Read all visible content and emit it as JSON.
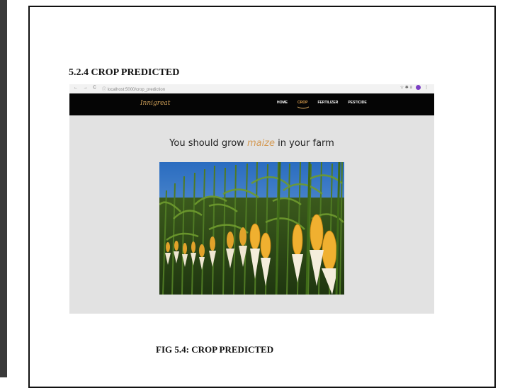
{
  "document": {
    "section_heading": "5.2.4 CROP PREDICTED",
    "caption": "FIG 5.4: CROP PREDICTED"
  },
  "browser": {
    "nav_icons": "← → C",
    "url": "ⓘ localhost:5000/crop_prediction",
    "right_icons": "☆ ✱ ≡"
  },
  "site": {
    "logo": "Innigreat",
    "nav": [
      {
        "label": "HOME"
      },
      {
        "label": "CROP",
        "active": true
      },
      {
        "label": "FERTILIZER"
      },
      {
        "label": "PESTICIDE"
      }
    ]
  },
  "result": {
    "prefix": "You should grow",
    "crop": "maize",
    "suffix": "in your farm"
  },
  "image": {
    "icon": "maize-field-photo"
  }
}
